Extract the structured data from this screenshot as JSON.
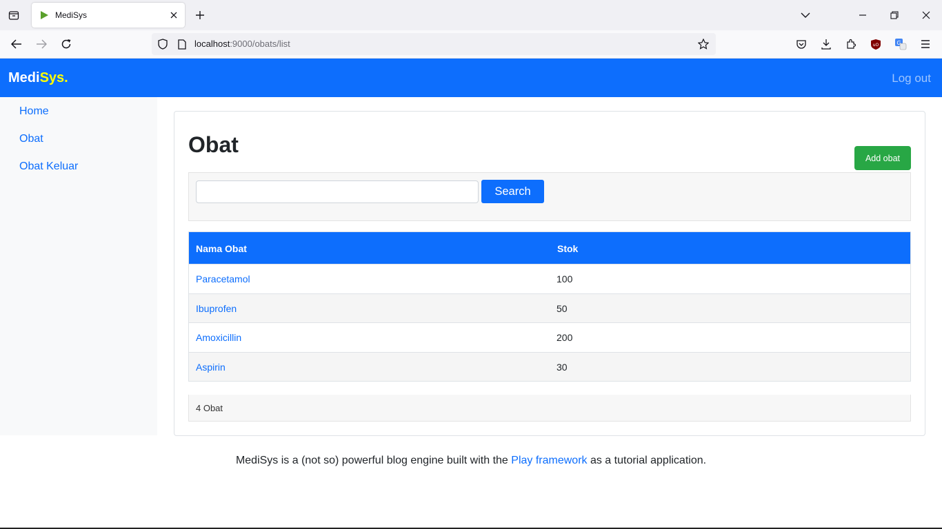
{
  "browser": {
    "tab_title": "MediSys",
    "url_host": "localhost",
    "url_rest": ":9000/obats/list"
  },
  "header": {
    "brand_main": "Medi",
    "brand_accent": "Sys.",
    "logout_label": "Log out"
  },
  "sidebar": {
    "items": [
      {
        "label": "Home"
      },
      {
        "label": "Obat"
      },
      {
        "label": "Obat Keluar"
      }
    ]
  },
  "main": {
    "title": "Obat",
    "add_button": "Add obat",
    "search": {
      "value": "",
      "placeholder": "",
      "button_label": "Search"
    },
    "table": {
      "headers": [
        "Nama Obat",
        "Stok"
      ],
      "rows": [
        {
          "name": "Paracetamol",
          "stok": "100"
        },
        {
          "name": "Ibuprofen",
          "stok": "50"
        },
        {
          "name": "Amoxicillin",
          "stok": "200"
        },
        {
          "name": "Aspirin",
          "stok": "30"
        }
      ]
    },
    "summary": "4 Obat"
  },
  "footer": {
    "before": "MediSys is a (not so) powerful blog engine built with the ",
    "link": "Play framework",
    "after": " as a tutorial application."
  },
  "colors": {
    "primary": "#0d6efd",
    "success": "#28a745",
    "brand_accent": "#ffff00"
  }
}
